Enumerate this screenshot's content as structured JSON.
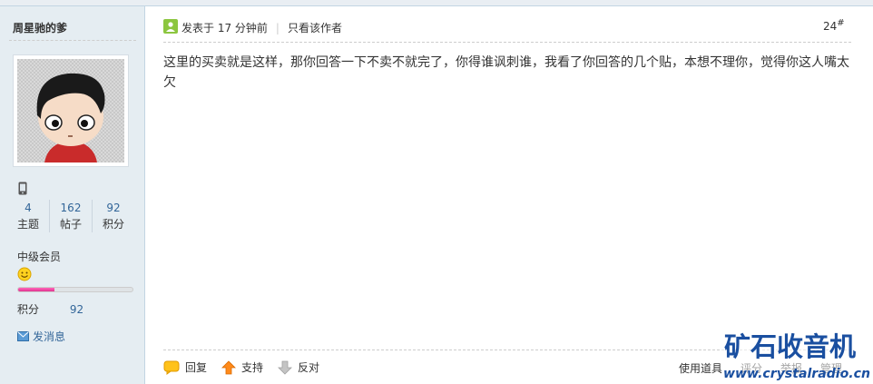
{
  "sidebar": {
    "username": "周星驰的爹",
    "stats": [
      {
        "value": "4",
        "label": "主题"
      },
      {
        "value": "162",
        "label": "帖子"
      },
      {
        "value": "92",
        "label": "积分"
      }
    ],
    "group": "中级会员",
    "progress_fraction": 0.32,
    "points_label": "积分",
    "points_value": "92",
    "pm_label": "发消息"
  },
  "post": {
    "posted_label": "发表于 17 分钟前",
    "separator": "|",
    "author_only": "只看该作者",
    "floor": "24",
    "floor_mark": "#",
    "content": "这里的买卖就是这样，那你回答一下不卖不就完了，你得谁讽刺谁，我看了你回答的几个贴，本想不理你，觉得你这人嘴太欠"
  },
  "actions": {
    "reply": "回复",
    "support": "支持",
    "oppose": "反对"
  },
  "tools": {
    "use_tools": "使用道具",
    "rate": "评分",
    "report": "举报",
    "manage": "管理"
  },
  "watermark": {
    "title": "矿石收音机",
    "url": "www.crystalradio.cn"
  },
  "colors": {
    "sidebar_bg": "#e5edf2",
    "link": "#336699",
    "progress": "#e0338f",
    "watermark": "#1a4fa0"
  },
  "icons": [
    "mobile-icon",
    "post-icon",
    "smiley-icon",
    "mail-icon",
    "reply-icon",
    "support-arrow-icon",
    "oppose-arrow-icon"
  ]
}
